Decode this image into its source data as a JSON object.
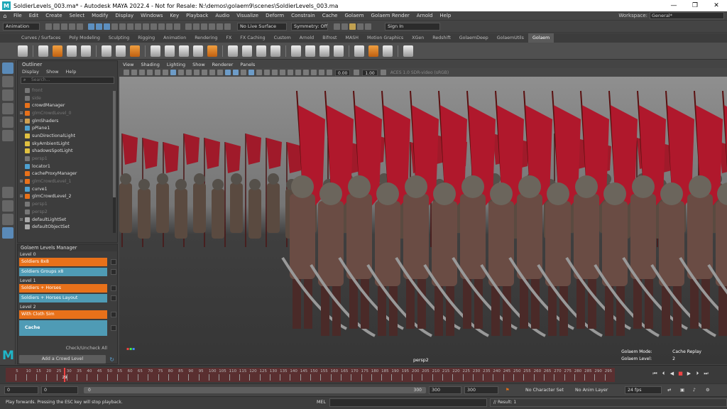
{
  "window": {
    "logo": "M",
    "title": "SoldierLevels_003.ma* - Autodesk MAYA 2022.4 - Not for Resale: N:\\demos\\golaem9\\scenes\\SoldierLevels_003.ma",
    "minimize": "—",
    "maximize": "❐",
    "close": "✕"
  },
  "menu": {
    "home_icon": "⌂",
    "items": [
      "File",
      "Edit",
      "Create",
      "Select",
      "Modify",
      "Display",
      "Windows",
      "Key",
      "Playback",
      "Audio",
      "Visualize",
      "Deform",
      "Constrain",
      "Cache",
      "Golaem",
      "Golaem Render",
      "Arnold",
      "Help"
    ],
    "workspace_label": "Workspace:",
    "workspace_value": "General*"
  },
  "statusline": {
    "mode": "Animation",
    "live_surface": "No Live Surface",
    "symmetry": "Symmetry: Off",
    "sign_in": "Sign In"
  },
  "shelf": {
    "tabs": [
      "Curves / Surfaces",
      "Poly Modeling",
      "Sculpting",
      "Rigging",
      "Animation",
      "Rendering",
      "FX",
      "FX Caching",
      "Custom",
      "Arnold",
      "Bifrost",
      "MASH",
      "Motion Graphics",
      "XGen",
      "Redshift",
      "GolaemDeep",
      "GolaemUtils",
      "Golaem"
    ],
    "active_tab": "Golaem"
  },
  "outliner": {
    "title": "Outliner",
    "menu": [
      "Display",
      "Show",
      "Help"
    ],
    "search_placeholder": "Search...",
    "items": [
      {
        "label": "front",
        "dim": true,
        "expand": "",
        "color": "#777"
      },
      {
        "label": "side",
        "dim": true,
        "expand": "",
        "color": "#777"
      },
      {
        "label": "crowdManager",
        "dim": false,
        "expand": "",
        "color": "#e8711a"
      },
      {
        "label": "glmCrowdLevel_0",
        "dim": true,
        "expand": "⊞",
        "color": "#e8711a"
      },
      {
        "label": "glmShaders",
        "dim": false,
        "expand": "⊞",
        "color": "#d0a050"
      },
      {
        "label": "pPlane1",
        "dim": false,
        "expand": "",
        "color": "#4ea0d0"
      },
      {
        "label": "sunDirectionalLight",
        "dim": false,
        "expand": "",
        "color": "#e0c040"
      },
      {
        "label": "skyAmbientLight",
        "dim": false,
        "expand": "",
        "color": "#e0c040"
      },
      {
        "label": "shadowsSpotLight",
        "dim": false,
        "expand": "",
        "color": "#e0c040"
      },
      {
        "label": "persp1",
        "dim": true,
        "expand": "",
        "color": "#777"
      },
      {
        "label": "locator1",
        "dim": false,
        "expand": "",
        "color": "#4ea0d0"
      },
      {
        "label": "cacheProxyManager",
        "dim": false,
        "expand": "",
        "color": "#e8711a"
      },
      {
        "label": "glmCrowdLevel_1",
        "dim": true,
        "expand": "⊞",
        "color": "#e8711a"
      },
      {
        "label": "curve1",
        "dim": false,
        "expand": "",
        "color": "#4ea0d0"
      },
      {
        "label": "glmCrowdLevel_2",
        "dim": false,
        "expand": "⊞",
        "color": "#e8711a"
      },
      {
        "label": "persp1",
        "dim": true,
        "expand": "",
        "color": "#777"
      },
      {
        "label": "persp2",
        "dim": true,
        "expand": "",
        "color": "#777"
      },
      {
        "label": "defaultLightSet",
        "dim": false,
        "expand": "⊞",
        "color": "#aaa"
      },
      {
        "label": "defaultObjectSet",
        "dim": false,
        "expand": "",
        "color": "#aaa"
      }
    ]
  },
  "levels": {
    "title": "Golaem Levels Manager",
    "level0": "Level 0",
    "level1": "Level 1",
    "level2": "Level 2",
    "btn_soldiers_8x8": "Soldiers 8x8",
    "btn_soldiers_groups": "Soldiers Groups x8",
    "btn_soldiers_horses": "Soldiers + Horses",
    "btn_soldiers_horses_layout": "Soldiers + Horses Layout",
    "btn_with_cloth": "With Cloth Sim",
    "btn_cache": "Cache",
    "check_all": "Check/Uncheck All",
    "add_level": "Add a Crowd Level",
    "refresh_icon": "↻"
  },
  "viewport": {
    "menu": [
      "View",
      "Shading",
      "Lighting",
      "Show",
      "Renderer",
      "Panels"
    ],
    "exposure": "0.00",
    "gamma": "1.00",
    "colorspace": "ACES 1.0 SDR-video (sRGB)",
    "camera": "persp2",
    "hud": {
      "mode_label": "Golaem Mode:",
      "mode_value": "Cache Replay",
      "level_label": "Golaem Level:",
      "level_value": "2"
    }
  },
  "timeline": {
    "ticks": [
      "5",
      "10",
      "15",
      "20",
      "25",
      "30",
      "35",
      "40",
      "45",
      "50",
      "55",
      "60",
      "65",
      "70",
      "75",
      "80",
      "85",
      "90",
      "95",
      "100",
      "105",
      "110",
      "115",
      "120",
      "125",
      "130",
      "135",
      "140",
      "145",
      "150",
      "155",
      "160",
      "165",
      "170",
      "175",
      "180",
      "185",
      "190",
      "195",
      "200",
      "205",
      "210",
      "215",
      "220",
      "225",
      "230",
      "235",
      "240",
      "245",
      "250",
      "255",
      "260",
      "265",
      "270",
      "275",
      "280",
      "285",
      "290",
      "295"
    ],
    "current_frame": "29",
    "current_frame_ratio": 0.095,
    "buttons": [
      "⏮",
      "⏴",
      "◀",
      "■",
      "▶",
      "⏵",
      "⏭"
    ]
  },
  "range": {
    "start": "0",
    "anim_start": "0",
    "slider_start": "0",
    "slider_end": "300",
    "anim_end": "300",
    "end": "300",
    "character_set": "No Character Set",
    "anim_layer": "No Anim Layer",
    "fps": "24 fps"
  },
  "helpline": {
    "help_text": "Play forwards. Pressing the ESC key will stop playback.",
    "mel_label": "MEL",
    "result": "// Result: 1"
  }
}
